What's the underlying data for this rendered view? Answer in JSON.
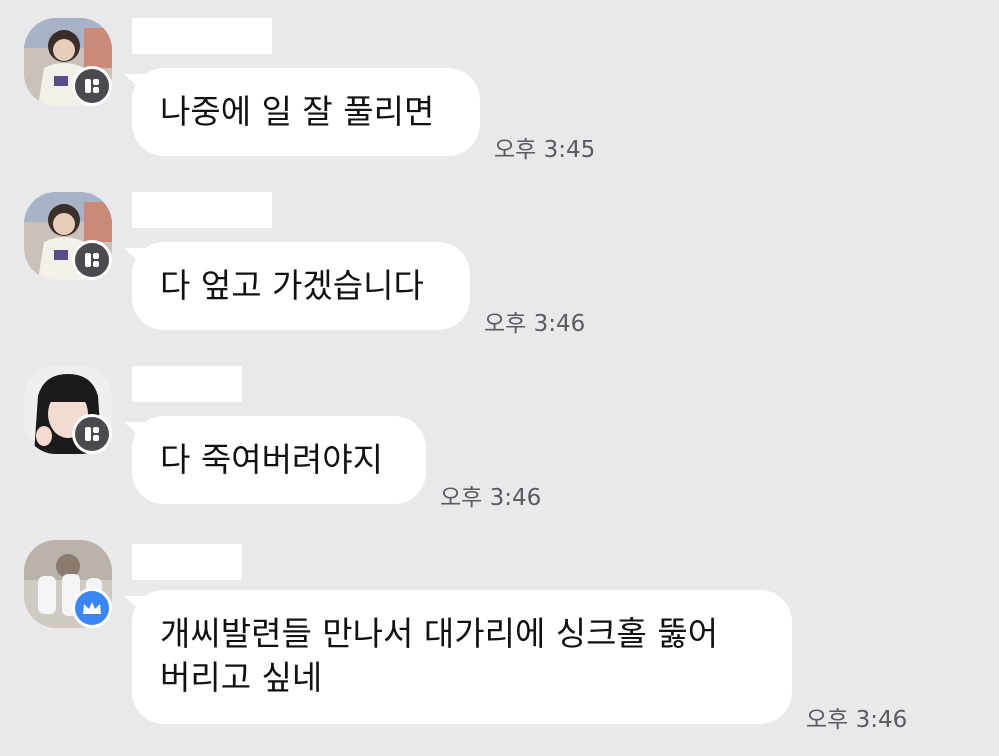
{
  "messages": [
    {
      "text": "나중에 일 잘 풀리면",
      "time": "오후 3:45",
      "badge": "dark",
      "avatar": "photo-a"
    },
    {
      "text": "다 엎고 가겠습니다",
      "time": "오후 3:46",
      "badge": "dark",
      "avatar": "photo-a"
    },
    {
      "text": "다 죽여버려야지",
      "time": "오후 3:46",
      "badge": "dark",
      "avatar": "photo-b"
    },
    {
      "text": "개씨발련들 만나서 대가리에 싱크홀 뚫어\n버리고 싶네",
      "time": "오후 3:46",
      "badge": "crown",
      "avatar": "photo-c"
    }
  ],
  "colors": {
    "background": "#e9e9eb",
    "bubble": "#ffffff",
    "time_text": "#5b5b5f",
    "badge_dark": "#4a4a4f",
    "badge_blue": "#3b86f7"
  }
}
